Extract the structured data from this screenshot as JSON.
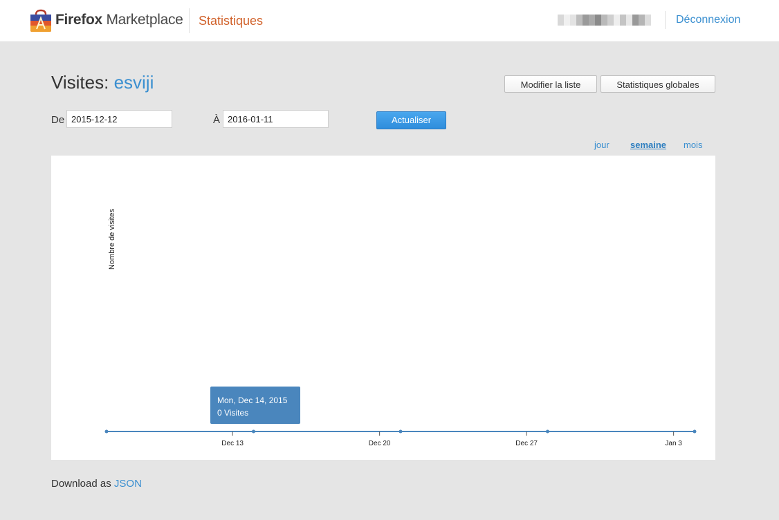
{
  "header": {
    "brand_bold": "Firefox",
    "brand_rest": " Marketplace",
    "section": "Statistiques",
    "logout": "Déconnexion",
    "username_blurred": true
  },
  "page": {
    "title_prefix": "Visites: ",
    "app_name": "esviji",
    "edit_list": "Modifier la liste",
    "global_stats": "Statistiques globales"
  },
  "filters": {
    "from_label": "De",
    "from_value": "2015-12-12",
    "to_label": "À",
    "to_value": "2016-01-11",
    "update_label": "Actualiser"
  },
  "periods": {
    "day": "jour",
    "week": "semaine",
    "month": "mois",
    "selected": "semaine"
  },
  "chart_data": {
    "type": "line",
    "ylabel": "Nombre de visites",
    "xlabel": "",
    "x_ticks": [
      "Dec 13",
      "Dec 20",
      "Dec 27",
      "Jan 3"
    ],
    "x": [
      "2015-12-07",
      "2015-12-14",
      "2015-12-21",
      "2015-12-28",
      "2016-01-04"
    ],
    "series": [
      {
        "values": [
          0,
          0,
          0,
          0,
          0
        ]
      }
    ],
    "line_color": "#4a86bd",
    "tooltip": {
      "date": "Mon, Dec 14, 2015",
      "value": "0 Visites"
    }
  },
  "download": {
    "text": "Download as ",
    "link": "JSON"
  }
}
